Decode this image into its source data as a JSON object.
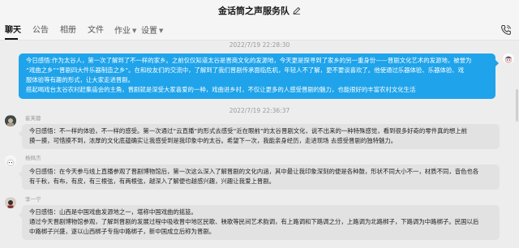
{
  "window": {
    "title": "金话筒之声服务队"
  },
  "tabs": [
    {
      "label": "聊天",
      "active": true
    },
    {
      "label": "公告"
    },
    {
      "label": "相册"
    },
    {
      "label": "文件"
    },
    {
      "label": "作业"
    },
    {
      "label": "设置"
    }
  ],
  "messages": [
    {
      "timestamp": "2022/7/19 22:28:30",
      "side": "right",
      "style": "blue",
      "lines": [
        "今日感悟:作为太谷人，第一次了解到了不一样的家乡。之前仅仅知道太谷是晋商文化的发源地，今天更是探寻到了家乡的另一重身份——晋剧文化艺术的发源地，被誉为",
        "“戏曲之乡”“晋剧四大件乐器制造之乡”。在和校友们的交流中，了解到了我们晋剧传承面临危机，年轻人不了解，更不要谈喜欢了。他使通过乐器体验、乐器体验、戏",
        "服体验等有趣的形式，让大家走进晋剧。",
        "搭起喝戏台太谷农村赶集庙会的主角，晋剧就是深受大家喜爱的一种，戏曲进乡村，不仅让更多的人感受晋剧的魅力，也能很好的丰富农村文化生活"
      ]
    },
    {
      "timestamp": "2022/7/19 22:36:37",
      "sender": "崔芙蓉",
      "side": "left",
      "style": "gray",
      "lines": [
        "今日感悟：不一样的体验，不一样的感受。第一次通过“云直播”的形式去感受“近在眼前”的太谷晋剧文化，说不出来的一种特殊感觉，看到很多好奇的零件真的想上前",
        "摸一摸，可惜摸不到，浓厚的文化底蕴确实让我感受到是我印象中的太谷。希望下一次，我能亲身经历，走进现场 去感受晋剧的独特魅力。"
      ]
    },
    {
      "sender": "杨佩杰",
      "side": "left",
      "style": "gray",
      "lines": [
        "今日感悟：在今天参与线上直播参观了晋剧博物馆后，第一次这么深入了解晋剧的文化内涵，其中最让我印象深刻的便是各种鼓，形状不同大小不一，材质不同，音色也各",
        "有千秋，有布，有皮，有三根弦，有两根弦，越深入了解便也越感兴趣，兴趣让我爱上晋剧。"
      ]
    },
    {
      "sender": "李一宁",
      "side": "left",
      "style": "gray",
      "lines": [
        "今日感悟：山西是中国戏曲发源地之一，堪称中国戏曲的摇篮。",
        "通过今天晋剧博物馆参观，了解到晋剧的发展过程中吸收晋中地区民歌、秧歌等民间艺术韵调，有上路调和下路调之分，上路调为北路梆子，下路调为中路梆子。民国以后",
        "中路梆子兴盛，逐以山西梆子专指中路梆子，新中国成立后称为晋剧。"
      ]
    }
  ],
  "icons": {
    "edit": "pencil-icon",
    "call": "phone-icon"
  },
  "colors": {
    "bubble_self": "#1fa3ea",
    "bubble_other": "#e2e2e2",
    "background": "#ededed"
  }
}
